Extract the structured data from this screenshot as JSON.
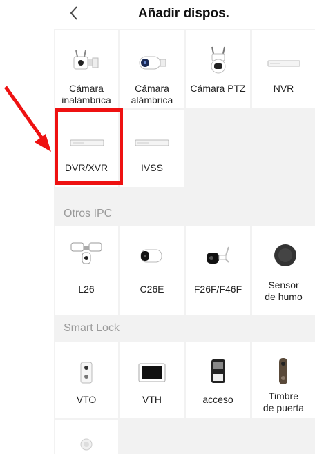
{
  "header": {
    "back_icon": "chevron-left-icon",
    "title": "Añadir dispos."
  },
  "section1": {
    "tiles": [
      {
        "line1": "Cámara",
        "line2": "inalámbrica",
        "icon": "wireless-camera-icon"
      },
      {
        "line1": "Cámara",
        "line2": "alámbrica",
        "icon": "wired-camera-icon"
      },
      {
        "line1": "Cámara PTZ",
        "line2": "",
        "icon": "ptz-camera-icon"
      },
      {
        "line1": "NVR",
        "line2": "",
        "icon": "nvr-icon"
      },
      {
        "line1": "DVR/XVR",
        "line2": "",
        "icon": "dvr-icon"
      },
      {
        "line1": "IVSS",
        "line2": "",
        "icon": "ivss-icon"
      }
    ]
  },
  "section2": {
    "title": "Otros IPC",
    "tiles": [
      {
        "line1": "L26",
        "line2": "",
        "icon": "floodlight-camera-icon"
      },
      {
        "line1": "C26E",
        "line2": "",
        "icon": "bullet-camera-icon"
      },
      {
        "line1": "F26F/F46F",
        "line2": "",
        "icon": "wifi-camera-icon"
      },
      {
        "line1": "Sensor",
        "line2": "de humo",
        "icon": "smoke-sensor-icon"
      }
    ]
  },
  "section3": {
    "title": "Smart Lock",
    "tiles": [
      {
        "line1": "VTO",
        "line2": "",
        "icon": "door-station-icon"
      },
      {
        "line1": "VTH",
        "line2": "",
        "icon": "indoor-monitor-icon"
      },
      {
        "line1": "acceso",
        "line2": "",
        "icon": "access-control-icon"
      },
      {
        "line1": "Timbre",
        "line2": "de puerta",
        "icon": "doorbell-icon"
      },
      {
        "line1": "",
        "line2": "",
        "icon": "round-device-icon"
      }
    ]
  },
  "annotation": {
    "color": "#e11111"
  }
}
